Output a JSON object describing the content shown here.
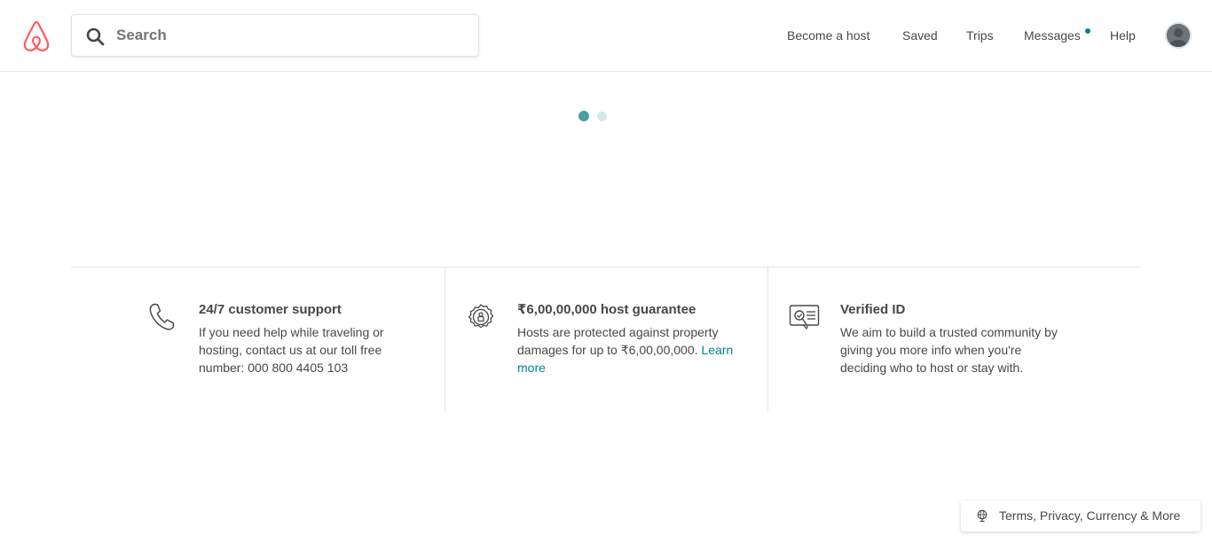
{
  "header": {
    "search": {
      "placeholder": "Search",
      "value": ""
    },
    "nav": {
      "become_host": "Become a host",
      "saved": "Saved",
      "trips": "Trips",
      "messages": "Messages",
      "help": "Help"
    }
  },
  "features": [
    {
      "icon": "phone-icon",
      "title": "24/7 customer support",
      "lines": [
        "If you need help while traveling or",
        "hosting, contact us at our toll free",
        "number: 000 800 4405 103"
      ]
    },
    {
      "icon": "badge-icon",
      "title": "₹6,00,00,000 host guarantee",
      "line1": "Hosts are protected against property",
      "line2": "damages for up to ₹6,00,00,000.",
      "link": "Learn",
      "link2": "more"
    },
    {
      "icon": "id-card-icon",
      "title": "Verified ID",
      "lines": [
        "We aim to build a trusted community by",
        "giving you more info when you're",
        "deciding who to host or stay with."
      ]
    }
  ],
  "footer": {
    "label": "Terms, Privacy, Currency & More",
    "icon": "globe-icon"
  },
  "colors": {
    "brand": "#FF5A5F",
    "accent": "#008489",
    "text": "#484848"
  }
}
